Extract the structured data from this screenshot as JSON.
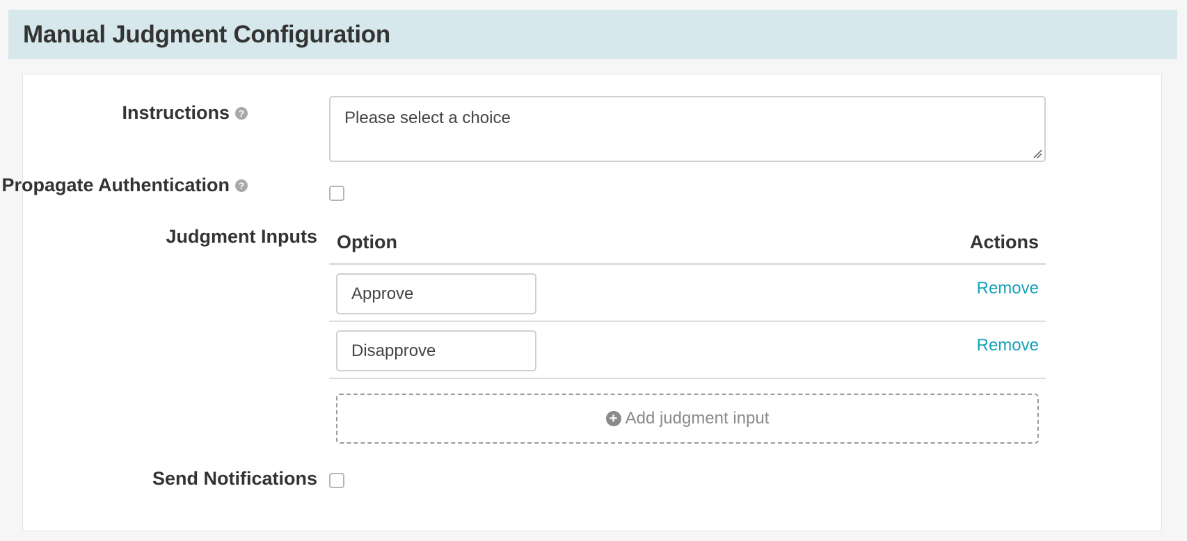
{
  "header": {
    "title": "Manual Judgment Configuration"
  },
  "form": {
    "instructions": {
      "label": "Instructions",
      "help_icon": "question-circle-icon",
      "value": "Please select a choice"
    },
    "propagate_authentication": {
      "label": "Propagate Authentication",
      "help_icon": "question-circle-icon",
      "checked": false
    },
    "judgment_inputs": {
      "label": "Judgment Inputs",
      "columns": [
        "Option",
        "Actions"
      ],
      "rows": [
        {
          "option": "Approve",
          "action": "Remove"
        },
        {
          "option": "Disapprove",
          "action": "Remove"
        }
      ],
      "add_label": "Add judgment input",
      "add_icon": "plus-circle-icon"
    },
    "send_notifications": {
      "label": "Send Notifications",
      "checked": false
    }
  },
  "colors": {
    "header_bg": "#d7e8ec",
    "link": "#17a2b8",
    "page_bg": "#f6f6f6"
  }
}
